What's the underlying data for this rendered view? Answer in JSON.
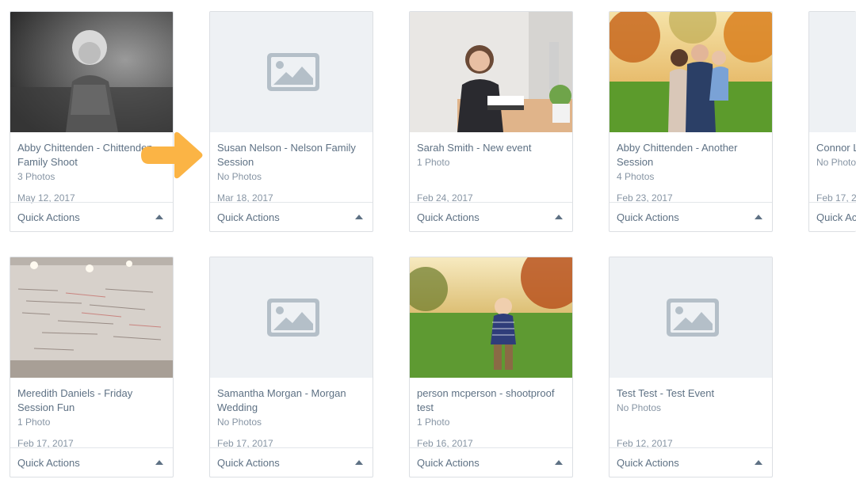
{
  "quick_actions_label": "Quick Actions",
  "galleries": [
    {
      "title": "Abby Chittenden - Chittenden Family Shoot",
      "count": "3 Photos",
      "date": "May 12, 2017",
      "thumb": "bw-child"
    },
    {
      "title": "Susan Nelson - Nelson Family Session",
      "count": "No Photos",
      "date": "Mar 18, 2017",
      "thumb": "placeholder"
    },
    {
      "title": "Sarah Smith - New event",
      "count": "1 Photo",
      "date": "Feb 24, 2017",
      "thumb": "office-woman"
    },
    {
      "title": "Abby Chittenden - Another Session",
      "count": "4 Photos",
      "date": "Feb 23, 2017",
      "thumb": "autumn-family"
    },
    {
      "title": "Connor L",
      "count": "No Photo",
      "date": "Feb 17, 20",
      "thumb": "placeholder"
    },
    {
      "title": "Meredith Daniels - Friday Session Fun",
      "count": "1 Photo",
      "date": "Feb 17, 2017",
      "thumb": "whiteboard"
    },
    {
      "title": "Samantha Morgan - Morgan Wedding",
      "count": "No Photos",
      "date": "Feb 17, 2017",
      "thumb": "placeholder"
    },
    {
      "title": "person mcperson - shootproof test",
      "count": "1 Photo",
      "date": "Feb 16, 2017",
      "thumb": "boy-field"
    },
    {
      "title": "Test Test - Test Event",
      "count": "No Photos",
      "date": "Feb 12, 2017",
      "thumb": "placeholder"
    }
  ],
  "partial_quick_actions_label": "Quick Ac",
  "colors": {
    "accent_arrow": "#fbb445",
    "text": "#5e7184",
    "muted": "#8795a4",
    "border": "#dcdfe3",
    "placeholder_bg": "#eef1f4",
    "placeholder_icon": "#b4bfc8"
  },
  "icons": {
    "placeholder": "image-placeholder-icon",
    "pointer": "arrow-pointer-icon",
    "dropdown": "caret-up-icon"
  }
}
